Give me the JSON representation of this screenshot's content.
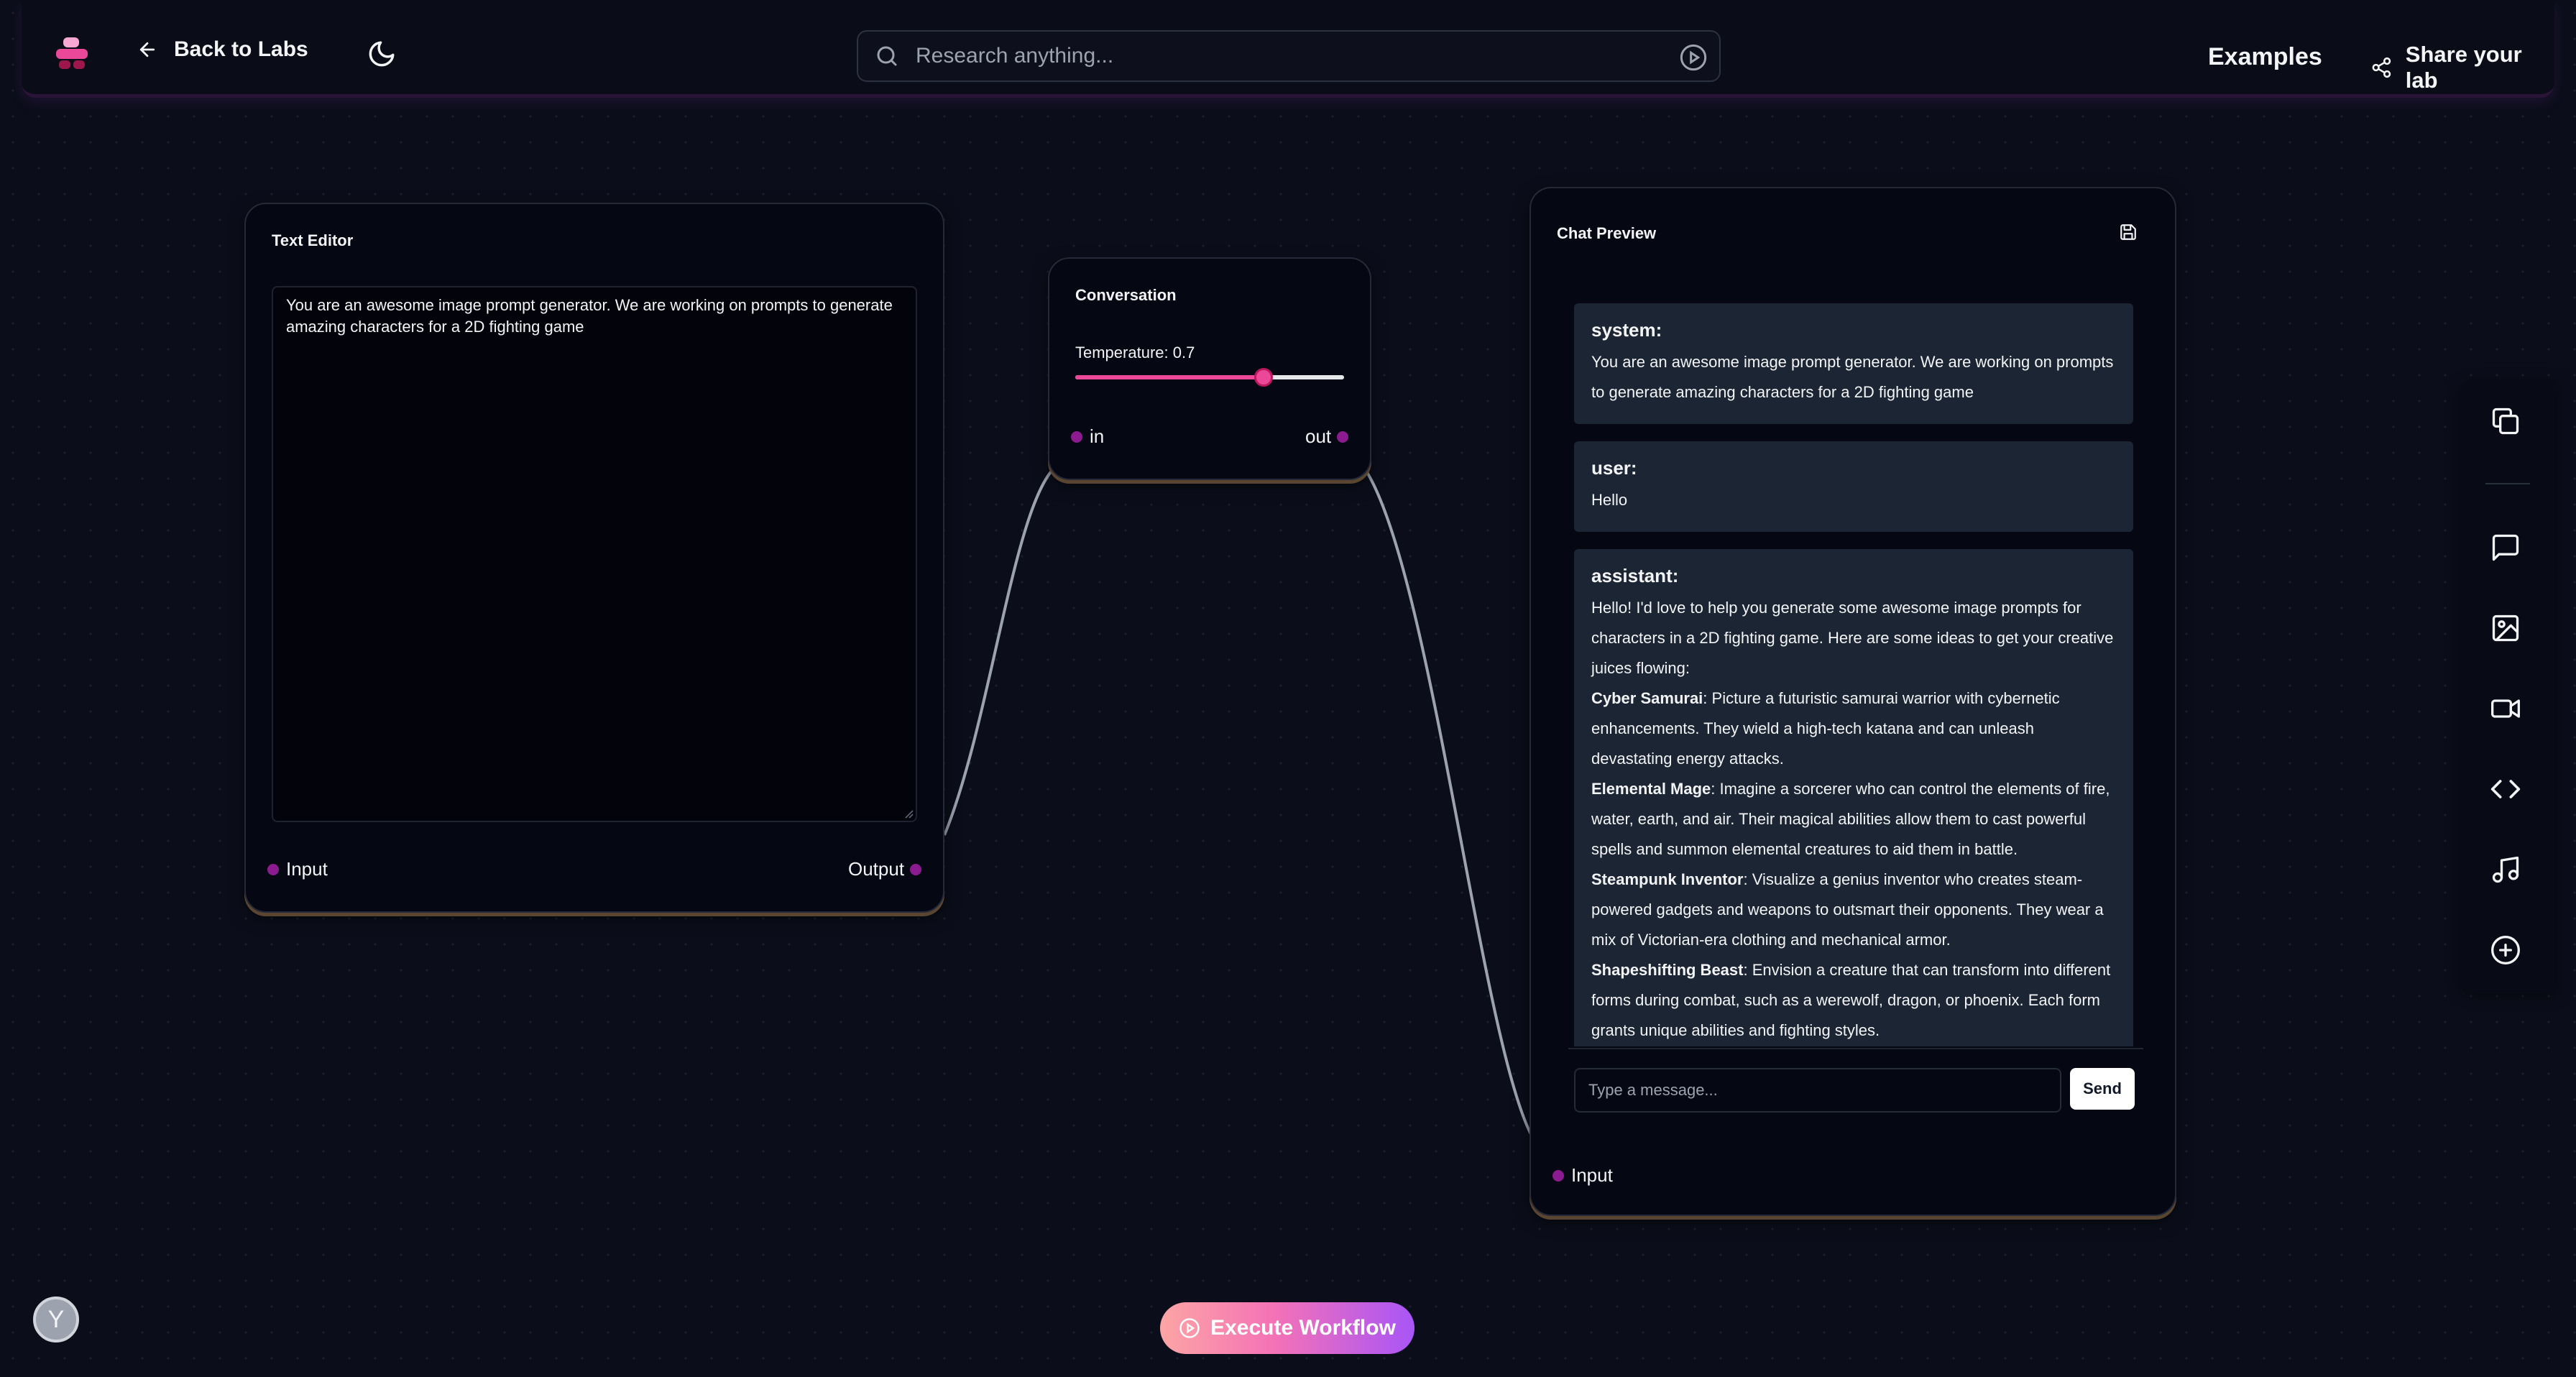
{
  "header": {
    "back_label": "Back to Labs",
    "search_placeholder": "Research anything...",
    "examples_label": "Examples",
    "share_label": "Share your lab"
  },
  "text_editor": {
    "title": "Text Editor",
    "content": "You are an awesome image prompt generator. We are working on prompts to generate amazing characters for a 2D fighting game",
    "input_label": "Input",
    "output_label": "Output"
  },
  "conversation": {
    "title": "Conversation",
    "temperature_label": "Temperature: 0.7",
    "temperature_value": 0.7,
    "in_label": "in",
    "out_label": "out"
  },
  "chat_preview": {
    "title": "Chat Preview",
    "messages": [
      {
        "role": "system:",
        "text": "You are an awesome image prompt generator. We are working on prompts to generate amazing characters for a 2D fighting game"
      },
      {
        "role": "user:",
        "text": "Hello"
      },
      {
        "role": "assistant:",
        "intro": "Hello! I'd love to help you generate some awesome image prompts for characters in a 2D fighting game. Here are some ideas to get your creative juices flowing:",
        "items": [
          {
            "name": "Cyber Samurai",
            "desc": ": Picture a futuristic samurai warrior with cybernetic enhancements. They wield a high-tech katana and can unleash devastating energy attacks."
          },
          {
            "name": "Elemental Mage",
            "desc": ": Imagine a sorcerer who can control the elements of fire, water, earth, and air. Their magical abilities allow them to cast powerful spells and summon elemental creatures to aid them in battle."
          },
          {
            "name": "Steampunk Inventor",
            "desc": ": Visualize a genius inventor who creates steam-powered gadgets and weapons to outsmart their opponents. They wear a mix of Victorian-era clothing and mechanical armor."
          },
          {
            "name": "Shapeshifting Beast",
            "desc": ": Envision a creature that can transform into different forms during combat, such as a werewolf, dragon, or phoenix. Each form grants unique abilities and fighting styles."
          }
        ]
      }
    ],
    "input_placeholder": "Type a message...",
    "send_label": "Send",
    "port_label": "Input"
  },
  "toolbar": {
    "icons": [
      "copy-icon",
      "chat-icon",
      "image-icon",
      "video-icon",
      "code-icon",
      "music-icon",
      "add-icon"
    ]
  },
  "execute_label": "Execute Workflow",
  "avatar_initial": "Y",
  "colors": {
    "background": "#0b0e1a",
    "port": "#8b1b8e",
    "slider_accent": "#ec4899",
    "message_bg": "#1c2533"
  }
}
